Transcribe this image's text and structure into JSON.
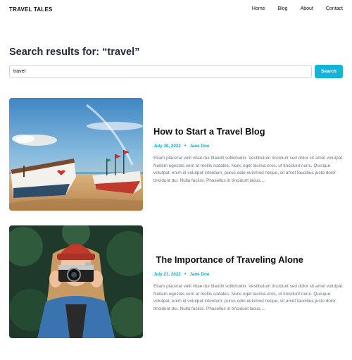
{
  "header": {
    "logo": "TRAVEL TALES",
    "nav": [
      "Home",
      "Blog",
      "About",
      "Contact"
    ]
  },
  "search": {
    "title": "Search results for: “travel”",
    "query": "travel",
    "button_label": "Search"
  },
  "results": [
    {
      "title": "How to Start a Travel Blog",
      "date": "July 30, 2022",
      "author": "Jane Doe",
      "excerpt": "Etiam placerat velit vitae dui blandit sollicitudin. Vestibulum tincidunt sed dolor sit amet volutpat. Nullam egestas sem at mollis sodales. Nunc eget lacinia eros, ut tincidunt nunc. Quisque volutpat, enim id volutpat interdum, purus odio euismod neque, sit amet faucibus justo dolor tincidunt dui. Nulla facilisi. Phasellus in tincidunt lacus,..."
    },
    {
      "title": " The Importance of Traveling Alone",
      "date": "July 21, 2022",
      "author": "Jane Doe",
      "excerpt": "Etiam placerat velit vitae dui blandit sollicitudin. Vestibulum tincidunt sed dolor sit amet volutpat. Nullam egestas sem at mollis sodales. Nunc eget lacinia eros, ut tincidunt nunc. Quisque volutpat, enim id volutpat interdum, purus odio euismod neque, sit amet faucibus justo dolor tincidunt dui. Nulla facilisi. Phasellus in tincidunt lacus,..."
    }
  ],
  "colors": {
    "accent": "#13b5d6",
    "meta": "#13a6c8"
  }
}
